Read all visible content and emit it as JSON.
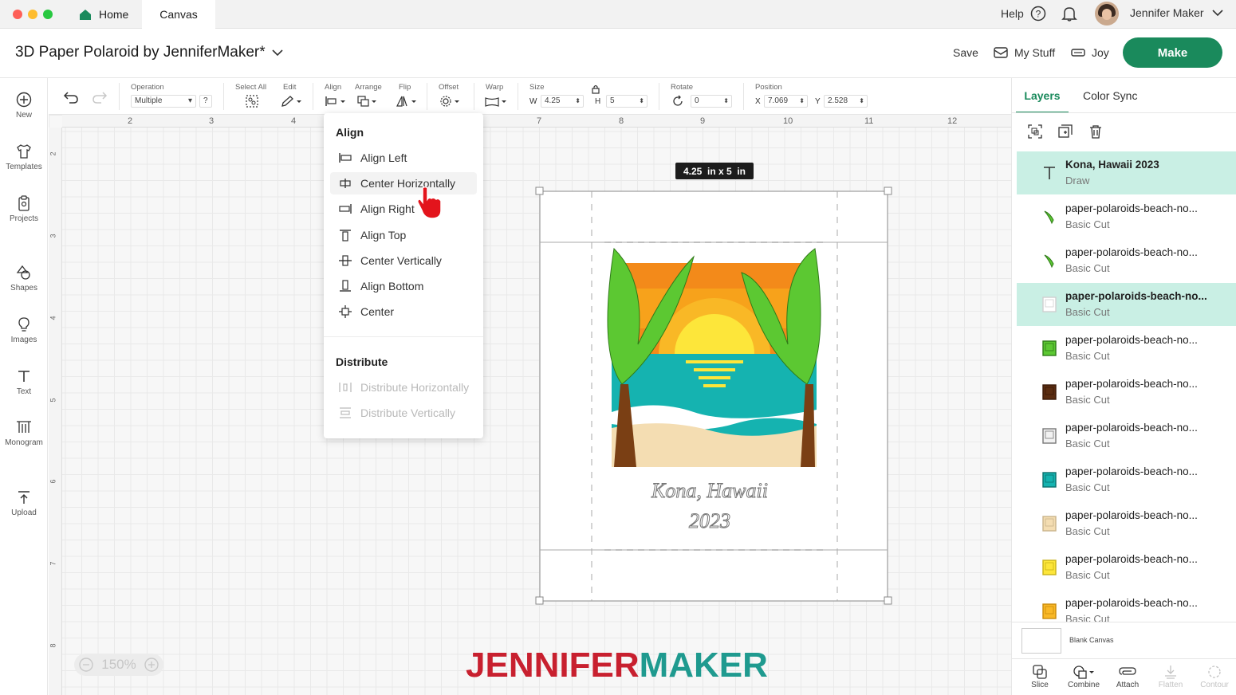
{
  "tabs": {
    "home": "Home",
    "canvas": "Canvas"
  },
  "top_right": {
    "help": "Help",
    "user": "Jennifer Maker"
  },
  "title": "3D Paper Polaroid by JenniferMaker*",
  "header_actions": {
    "save": "Save",
    "my_stuff": "My Stuff",
    "machine": "Joy",
    "make": "Make"
  },
  "left_sidebar": [
    {
      "label": "New",
      "icon": "plus-circle-icon"
    },
    {
      "label": "Templates",
      "icon": "tshirt-icon"
    },
    {
      "label": "Projects",
      "icon": "clipboard-icon"
    },
    {
      "label": "Shapes",
      "icon": "shapes-icon"
    },
    {
      "label": "Images",
      "icon": "lightbulb-icon"
    },
    {
      "label": "Text",
      "icon": "text-icon"
    },
    {
      "label": "Monogram",
      "icon": "monogram-icon"
    },
    {
      "label": "Upload",
      "icon": "upload-icon"
    }
  ],
  "toolbar": {
    "operation_label": "Operation",
    "operation_value": "Multiple",
    "operation_help": "?",
    "select_all": "Select All",
    "edit": "Edit",
    "align": "Align",
    "arrange": "Arrange",
    "flip": "Flip",
    "offset": "Offset",
    "warp": "Warp",
    "size": "Size",
    "w_label": "W",
    "w_value": "4.25",
    "h_label": "H",
    "h_value": "5",
    "rotate": "Rotate",
    "rotate_value": "0",
    "position": "Position",
    "x_label": "X",
    "x_value": "7.069",
    "y_label": "Y",
    "y_value": "2.528"
  },
  "ruler_top": [
    "2",
    "3",
    "4",
    "7",
    "8",
    "9",
    "10",
    "11",
    "12"
  ],
  "ruler_left": [
    "2",
    "3",
    "4",
    "5",
    "6",
    "7",
    "8"
  ],
  "align_menu": {
    "header": "Align",
    "items": [
      "Align Left",
      "Center Horizontally",
      "Align Right",
      "Align Top",
      "Center Vertically",
      "Align Bottom",
      "Center"
    ],
    "distribute_header": "Distribute",
    "distribute_items": [
      "Distribute Horizontally",
      "Distribute Vertically"
    ]
  },
  "size_badge": "4.25  in x 5  in",
  "design_text": {
    "line1": "Kona, Hawaii",
    "line2": "2023"
  },
  "zoom": "150%",
  "watermark": "JENNIFERMAKER",
  "panel_tabs": {
    "layers": "Layers",
    "color_sync": "Color Sync"
  },
  "layers": [
    {
      "name": "Kona, Hawaii 2023",
      "type": "Draw",
      "thumb": "text-t-icon",
      "selected": true
    },
    {
      "name": "paper-polaroids-beach-no...",
      "type": "Basic Cut",
      "thumb": "palm-leaf-icon",
      "selected": false
    },
    {
      "name": "paper-polaroids-beach-no...",
      "type": "Basic Cut",
      "thumb": "palm-leaf-icon",
      "selected": false
    },
    {
      "name": "paper-polaroids-beach-no...",
      "type": "Basic Cut",
      "thumb": "frame-white-icon",
      "selected": true
    },
    {
      "name": "paper-polaroids-beach-no...",
      "type": "Basic Cut",
      "thumb": "frame-green-icon",
      "selected": false
    },
    {
      "name": "paper-polaroids-beach-no...",
      "type": "Basic Cut",
      "thumb": "frame-brown-icon",
      "selected": false
    },
    {
      "name": "paper-polaroids-beach-no...",
      "type": "Basic Cut",
      "thumb": "frame-gray-icon",
      "selected": false
    },
    {
      "name": "paper-polaroids-beach-no...",
      "type": "Basic Cut",
      "thumb": "frame-teal-icon",
      "selected": false
    },
    {
      "name": "paper-polaroids-beach-no...",
      "type": "Basic Cut",
      "thumb": "frame-sand-icon",
      "selected": false
    },
    {
      "name": "paper-polaroids-beach-no...",
      "type": "Basic Cut",
      "thumb": "frame-yellow-icon",
      "selected": false
    },
    {
      "name": "paper-polaroids-beach-no...",
      "type": "Basic Cut",
      "thumb": "frame-orange-icon",
      "selected": false
    }
  ],
  "blank_canvas": "Blank Canvas",
  "bottom_tools": [
    "Slice",
    "Combine",
    "Attach",
    "Flatten",
    "Contour"
  ],
  "colors": {
    "accent": "#1a8a5c",
    "selected_layer": "#c9efe4",
    "watermark_red": "#c8202f",
    "watermark_teal": "#1f9a8f"
  }
}
